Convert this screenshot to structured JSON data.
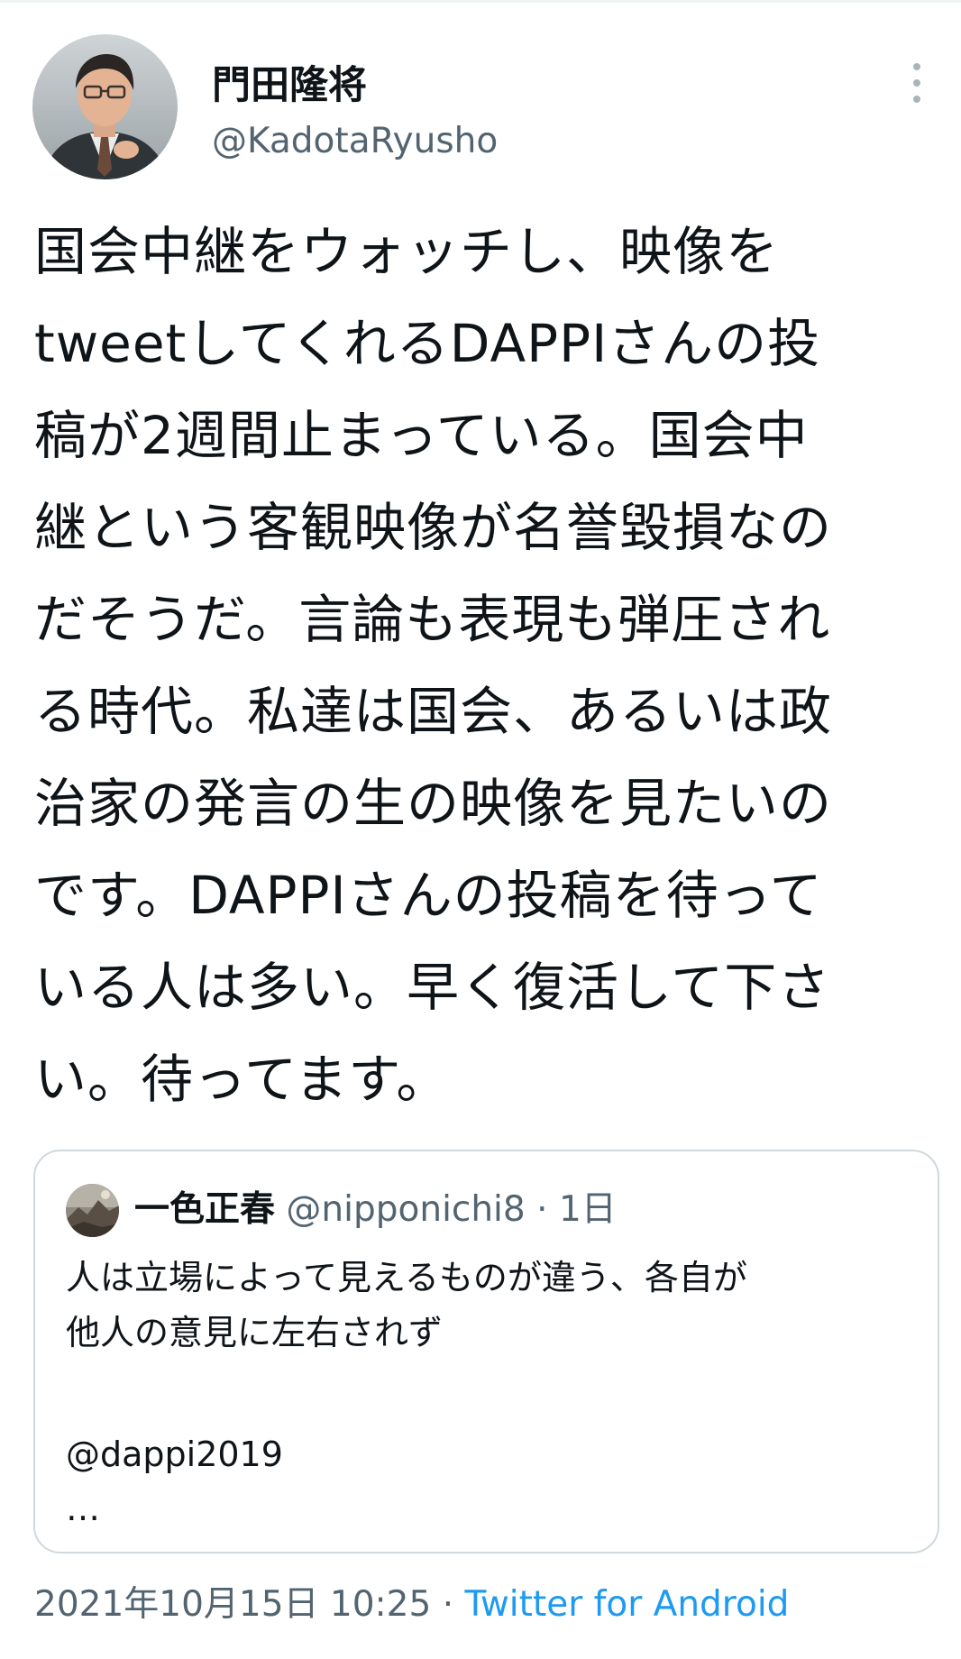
{
  "author": {
    "name": "門田隆将",
    "handle": "@KadotaRyusho",
    "avatar_icon": "profile-photo-man-glasses"
  },
  "menu": {
    "icon": "more-vertical-icon"
  },
  "tweet": {
    "lines": [
      "国会中継をウォッチし、映像を",
      "tweetしてくれるDAPPIさんの投",
      "稿が2週間止まっている。国会中",
      "継という客観映像が名誉毀損なの",
      "だそうだ。言論も表現も弾圧され",
      "る時代。私達は国会、あるいは政",
      "治家の発言の生の映像を見たいの",
      "です。DAPPIさんの投稿を待って",
      "いる人は多い。早く復活して下さ",
      "い。待ってます。"
    ]
  },
  "quote": {
    "name": "一色正春",
    "handle": "@nipponichi8",
    "separator": "·",
    "time": "1日",
    "avatar_icon": "profile-photo-landscape",
    "lines": [
      "人は立場によって見えるものが違う、各自が",
      "他人の意見に左右されず"
    ],
    "mention": "@dappi2019",
    "ellipsis": "…"
  },
  "meta": {
    "timestamp": "2021年10月15日 10:25",
    "separator": "·",
    "source": "Twitter for Android"
  },
  "colors": {
    "text_primary": "#0f1419",
    "text_secondary": "#536471",
    "link": "#1d9bf0",
    "border": "#cfd9de"
  }
}
